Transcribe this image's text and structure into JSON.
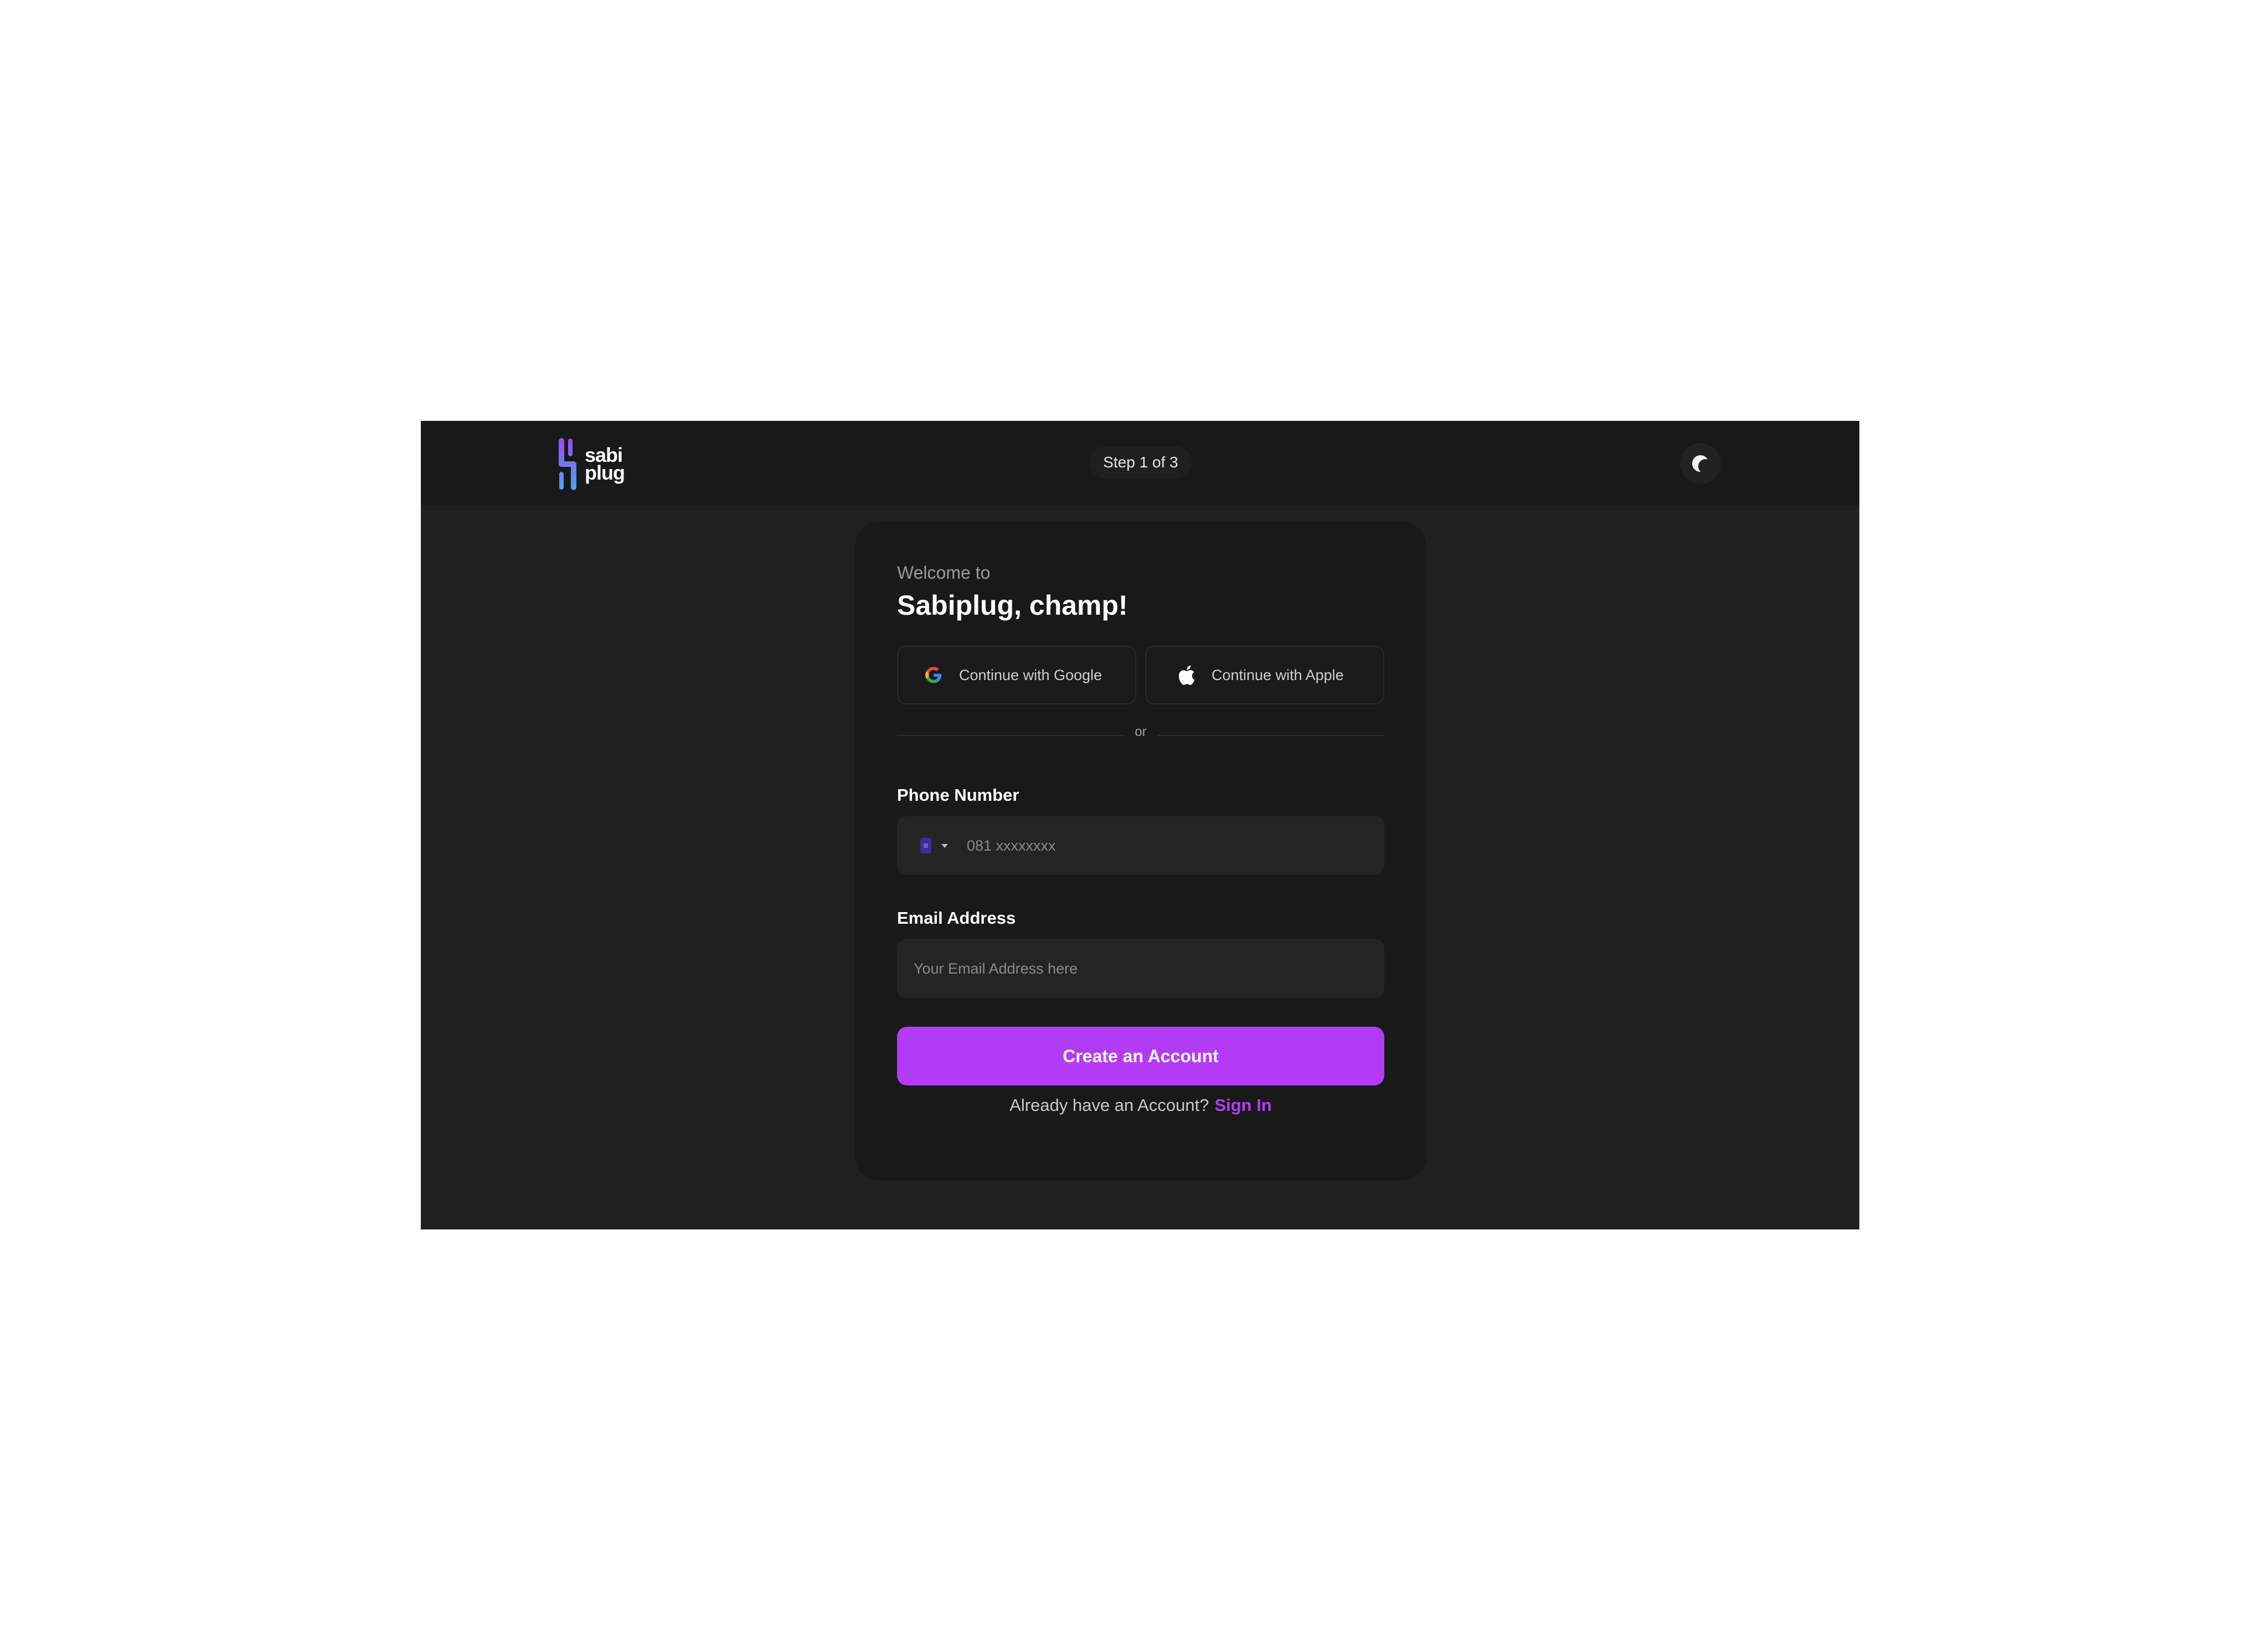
{
  "header": {
    "logo": {
      "line1": "sabi",
      "line2": "plug"
    },
    "step_label": "Step 1 of 3",
    "theme_toggle_icon": "moon-icon"
  },
  "card": {
    "welcome_sub": "Welcome to",
    "welcome_title": "Sabiplug, champ!",
    "google_button": {
      "label": "Continue with Google",
      "icon": "google-icon"
    },
    "apple_button": {
      "label": "Continue with Apple",
      "icon": "apple-icon"
    },
    "divider_text": "or",
    "phone": {
      "label": "Phone Number",
      "placeholder": "081 xxxxxxxx",
      "country_icon": "flag-icon"
    },
    "email": {
      "label": "Email Address",
      "placeholder": "Your Email Address here"
    },
    "cta_label": "Create an Account",
    "signin_prompt": "Already have an  Account?",
    "signin_link": "Sign In"
  },
  "colors": {
    "accent": "#b43bf5",
    "frame_bg": "#202020",
    "topbar_bg": "#191919",
    "card_bg": "#191919",
    "input_bg": "#242424"
  }
}
